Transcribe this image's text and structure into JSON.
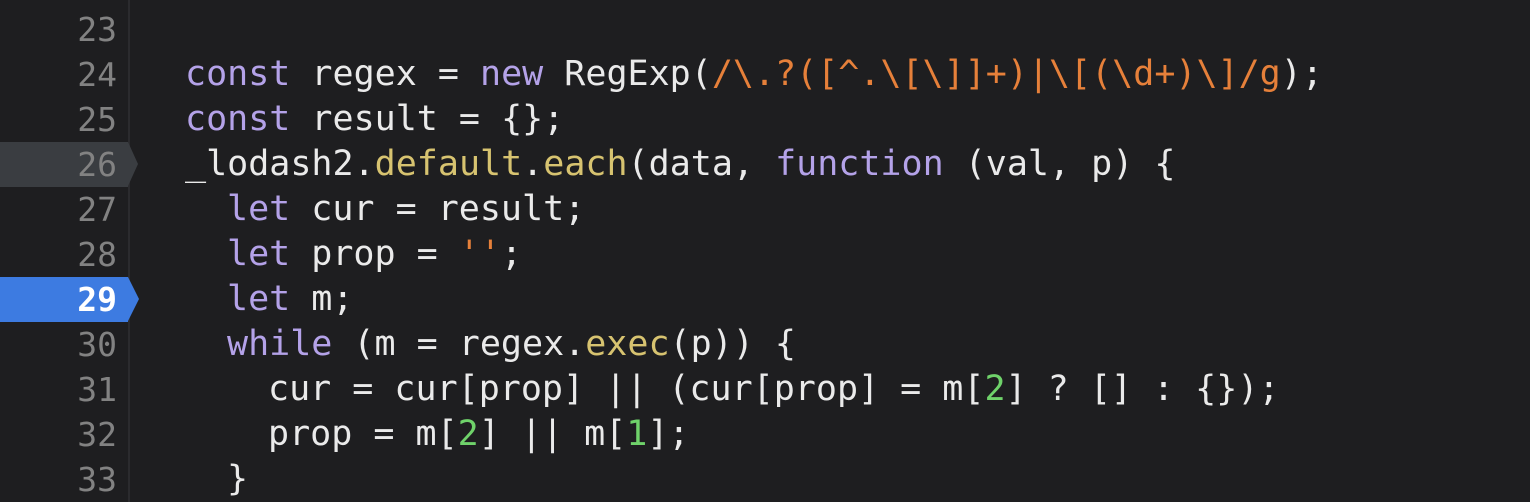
{
  "editor": {
    "gutter": [
      {
        "line": "23",
        "state": "none"
      },
      {
        "line": "24",
        "state": "none"
      },
      {
        "line": "25",
        "state": "none"
      },
      {
        "line": "26",
        "state": "hover-breakpoint"
      },
      {
        "line": "27",
        "state": "none"
      },
      {
        "line": "28",
        "state": "none"
      },
      {
        "line": "29",
        "state": "active-breakpoint"
      },
      {
        "line": "30",
        "state": "none"
      },
      {
        "line": "31",
        "state": "none"
      },
      {
        "line": "32",
        "state": "none"
      },
      {
        "line": "33",
        "state": "none"
      }
    ],
    "code": {
      "l24": {
        "kw_const": "const",
        "name": " regex = ",
        "kw_new": "new",
        "ctor": " RegExp(",
        "regex": "/\\.?([^.\\[\\]]+)|\\[(\\d+)\\]/g",
        "end": ");"
      },
      "l25": {
        "kw_const": "const",
        "rest": " result = {};"
      },
      "l26": {
        "obj": "_lodash2.",
        "prop1": "default",
        "dot": ".",
        "prop2": "each",
        "args": "(data, ",
        "kw_function": "function",
        "params": " (val, p) {"
      },
      "l27": {
        "kw_let": "let",
        "rest": " cur = result;"
      },
      "l28": {
        "kw_let": "let",
        "mid": " prop = ",
        "str": "''",
        "end": ";"
      },
      "l29": {
        "kw_let": "let",
        "rest": " m;"
      },
      "l30": {
        "kw_while": "while",
        "mid": " (m = regex.",
        "method": "exec",
        "end": "(p)) {"
      },
      "l31": {
        "a": "cur = cur[prop] || (cur[prop] = m[",
        "n": "2",
        "b": "] ? [] : {});"
      },
      "l32": {
        "a": "prop = m[",
        "n1": "2",
        "b": "] || m[",
        "n2": "1",
        "c": "];"
      },
      "l33": {
        "brace": "}"
      }
    },
    "colors": {
      "background": "#1e1e20",
      "keyword": "#b4a2e8",
      "function": "#d7c370",
      "string": "#e6803a",
      "number": "#6fd26a",
      "breakpoint_active": "#3d7be1",
      "breakpoint_hover": "#3a3d41"
    }
  }
}
